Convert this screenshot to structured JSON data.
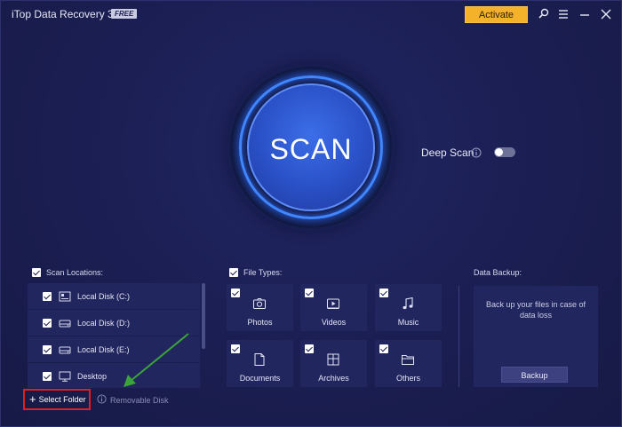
{
  "app": {
    "title": "iTop Data Recovery 3.3",
    "badge": "FREE"
  },
  "header": {
    "activate_label": "Activate",
    "icons": [
      "search-icon",
      "menu-icon",
      "minimize-icon",
      "close-icon"
    ]
  },
  "scan": {
    "label": "SCAN",
    "deep_scan_label": "Deep Scan",
    "deep_scan_enabled": false
  },
  "locations": {
    "heading": "Scan Locations:",
    "items": [
      {
        "label": "Local Disk (C:)",
        "icon": "system-drive-icon",
        "checked": true
      },
      {
        "label": "Local Disk (D:)",
        "icon": "drive-icon",
        "checked": true
      },
      {
        "label": "Local Disk (E:)",
        "icon": "drive-icon",
        "checked": true
      },
      {
        "label": "Desktop",
        "icon": "monitor-icon",
        "checked": true
      }
    ]
  },
  "file_types": {
    "heading": "File Types:",
    "items": [
      {
        "label": "Photos",
        "icon": "camera-icon",
        "checked": true
      },
      {
        "label": "Videos",
        "icon": "video-icon",
        "checked": true
      },
      {
        "label": "Music",
        "icon": "music-icon",
        "checked": true
      },
      {
        "label": "Documents",
        "icon": "document-icon",
        "checked": true
      },
      {
        "label": "Archives",
        "icon": "archive-icon",
        "checked": true
      },
      {
        "label": "Others",
        "icon": "folder-icon",
        "checked": true
      }
    ]
  },
  "backup": {
    "heading": "Data Backup:",
    "description": "Back up your files in case of data loss",
    "button_label": "Backup"
  },
  "footer": {
    "select_folder_label": "Select Folder",
    "removable_label": "Removable Disk"
  },
  "colors": {
    "accent": "#f4b12a",
    "scan_blue": "#2a50c6",
    "highlight_box": "#e02020",
    "annotation_arrow": "#3aa33a"
  }
}
